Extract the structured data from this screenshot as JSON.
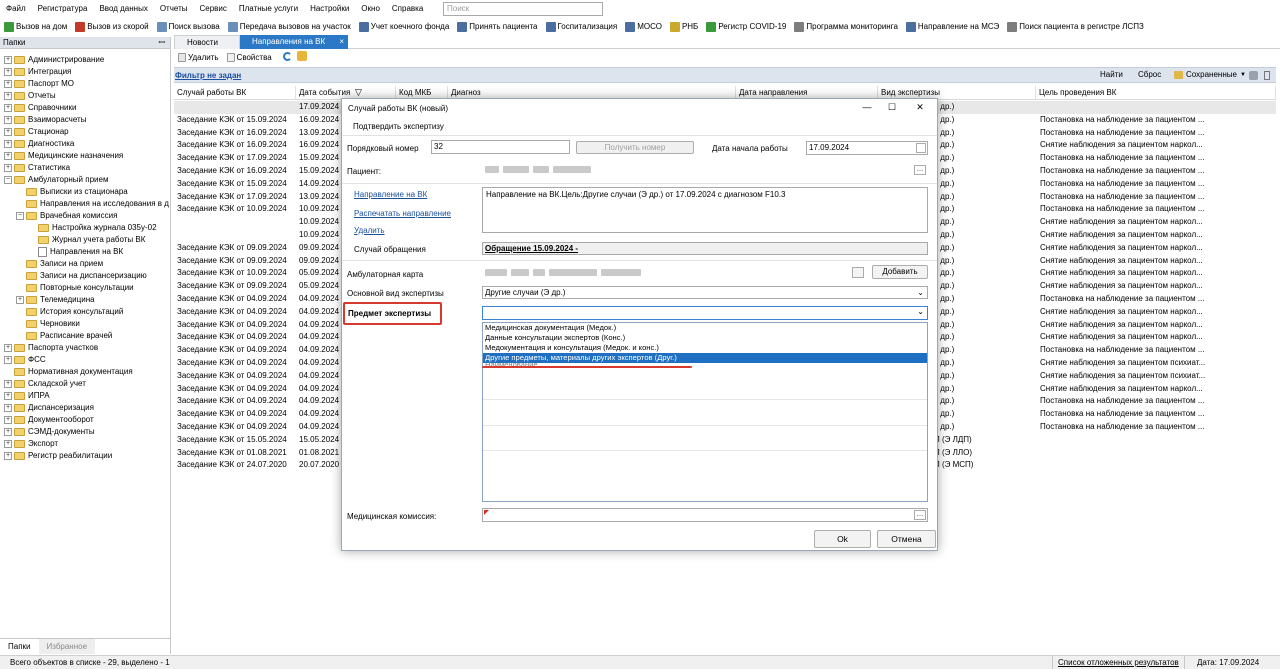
{
  "menu": [
    "Файл",
    "Регистратура",
    "Ввод данных",
    "Отчеты",
    "Сервис",
    "Платные услуги",
    "Настройки",
    "Окно",
    "Справка"
  ],
  "search_placeholder": "Поиск",
  "toolbar": [
    {
      "label": "Вызов на дом",
      "color": "#3a9a3a"
    },
    {
      "label": "Вызов из скорой",
      "color": "#c23a2a"
    },
    {
      "label": "Поиск вызова",
      "color": "#6a8fb8"
    },
    {
      "label": "Передача вызовов на участок",
      "color": "#6a8fb8"
    },
    {
      "label": "Учет коечного фонда",
      "color": "#4c6e9e"
    },
    {
      "label": "Принять пациента",
      "color": "#4c6e9e"
    },
    {
      "label": "Госпитализация",
      "color": "#4c6e9e"
    },
    {
      "label": "МОСО",
      "color": "#4c6e9e"
    },
    {
      "label": "РНБ",
      "color": "#c9a82c"
    },
    {
      "label": "Регистр COVID-19",
      "color": "#3a9a3a"
    },
    {
      "label": "Программа мониторинга",
      "color": "#7d7d7d"
    },
    {
      "label": "Направление на МСЭ",
      "color": "#4c6e9e"
    },
    {
      "label": "Поиск пациента в регистре ЛСПЗ",
      "color": "#7d7d7d"
    }
  ],
  "left_panel": {
    "title": "Папки",
    "pin": "ꟷ",
    "tree": [
      {
        "label": "Администрирование",
        "level": 0,
        "exp": "+",
        "icon": "folder"
      },
      {
        "label": "Интеграция",
        "level": 0,
        "exp": "+",
        "icon": "folder"
      },
      {
        "label": "Паспорт МО",
        "level": 0,
        "exp": "+",
        "icon": "folder"
      },
      {
        "label": "Отчеты",
        "level": 0,
        "exp": "+",
        "icon": "folder"
      },
      {
        "label": "Справочники",
        "level": 0,
        "exp": "+",
        "icon": "folder"
      },
      {
        "label": "Взаиморасчеты",
        "level": 0,
        "exp": "+",
        "icon": "folder"
      },
      {
        "label": "Стационар",
        "level": 0,
        "exp": "+",
        "icon": "folder"
      },
      {
        "label": "Диагностика",
        "level": 0,
        "exp": "+",
        "icon": "folder"
      },
      {
        "label": "Медицинские назначения",
        "level": 0,
        "exp": "+",
        "icon": "folder"
      },
      {
        "label": "Статистика",
        "level": 0,
        "exp": "+",
        "icon": "folder"
      },
      {
        "label": "Амбулаторный прием",
        "level": 0,
        "exp": "−",
        "icon": "folder"
      },
      {
        "label": "Выписки из стационара",
        "level": 1,
        "exp": "",
        "icon": "folder"
      },
      {
        "label": "Направления на исследования в д",
        "level": 1,
        "exp": "",
        "icon": "folder"
      },
      {
        "label": "Врачебная комиссия",
        "level": 1,
        "exp": "−",
        "icon": "folder"
      },
      {
        "label": "Настройка журнала 035у-02",
        "level": 2,
        "exp": "",
        "icon": "folder"
      },
      {
        "label": "Журнал учета работы ВК",
        "level": 2,
        "exp": "",
        "icon": "folder"
      },
      {
        "label": "Направления на ВК",
        "level": 2,
        "exp": "",
        "icon": "doc"
      },
      {
        "label": "Записи на прием",
        "level": 1,
        "exp": "",
        "icon": "folder"
      },
      {
        "label": "Записи на диспансеризацию",
        "level": 1,
        "exp": "",
        "icon": "folder"
      },
      {
        "label": "Повторные консультации",
        "level": 1,
        "exp": "",
        "icon": "folder"
      },
      {
        "label": "Телемедицина",
        "level": 1,
        "exp": "+",
        "icon": "folder"
      },
      {
        "label": "История консультаций",
        "level": 1,
        "exp": "",
        "icon": "folder"
      },
      {
        "label": "Черновики",
        "level": 1,
        "exp": "",
        "icon": "folder"
      },
      {
        "label": "Расписание врачей",
        "level": 1,
        "exp": "",
        "icon": "folder"
      },
      {
        "label": "Паспорта участков",
        "level": 0,
        "exp": "+",
        "icon": "folder"
      },
      {
        "label": "ФСС",
        "level": 0,
        "exp": "+",
        "icon": "folder"
      },
      {
        "label": "Нормативная документация",
        "level": 0,
        "exp": "",
        "icon": "folder"
      },
      {
        "label": "Складской учет",
        "level": 0,
        "exp": "+",
        "icon": "folder"
      },
      {
        "label": "ИПРА",
        "level": 0,
        "exp": "+",
        "icon": "folder"
      },
      {
        "label": "Диспансеризация",
        "level": 0,
        "exp": "+",
        "icon": "folder"
      },
      {
        "label": "Документооборот",
        "level": 0,
        "exp": "+",
        "icon": "folder"
      },
      {
        "label": "СЭМД-документы",
        "level": 0,
        "exp": "+",
        "icon": "folder"
      },
      {
        "label": "Экспорт",
        "level": 0,
        "exp": "+",
        "icon": "folder"
      },
      {
        "label": "Регистр реабилитации",
        "level": 0,
        "exp": "+",
        "icon": "folder"
      }
    ],
    "tabs": [
      "Папки",
      "Избранное"
    ]
  },
  "tabs": {
    "news": "Новости",
    "vk": "Направления на ВК",
    "close": "×"
  },
  "sub_toolbar": {
    "delete": "Удалить",
    "props": "Свойства"
  },
  "filter": {
    "link": "Фильтр не задан",
    "find": "Найти",
    "reset": "Сброс",
    "saved": "Сохраненные"
  },
  "table": {
    "headers": [
      "Случай работы ВК",
      "Дата события",
      "Код МКБ",
      "Диагноз",
      "Дата направления",
      "Вид экспертизы",
      "Цель проведения ВК"
    ],
    "rows": [
      {
        "case": "",
        "date": "17.09.2024",
        "kind": "э др.)",
        "goal": ""
      },
      {
        "case": "Заседание КЭК от 15.09.2024",
        "date": "16.09.2024",
        "kind": "э др.)",
        "goal": "Постановка на наблюдение за пациентом ..."
      },
      {
        "case": "Заседание КЭК от 16.09.2024",
        "date": "13.09.2024",
        "kind": "э др.)",
        "goal": "Постановка на наблюдение за пациентом ..."
      },
      {
        "case": "Заседание КЭК от 16.09.2024",
        "date": "16.09.2024",
        "kind": "э др.)",
        "goal": "Снятие наблюдения за пациентом наркол..."
      },
      {
        "case": "Заседание КЭК от 17.09.2024",
        "date": "15.09.2024",
        "kind": "э др.)",
        "goal": "Постановка на наблюдение за пациентом ..."
      },
      {
        "case": "Заседание КЭК от 16.09.2024",
        "date": "15.09.2024",
        "kind": "э др.)",
        "goal": "Постановка на наблюдение за пациентом ..."
      },
      {
        "case": "Заседание КЭК от 15.09.2024",
        "date": "14.09.2024",
        "kind": "э др.)",
        "goal": "Постановка на наблюдение за пациентом ..."
      },
      {
        "case": "Заседание КЭК от 17.09.2024",
        "date": "13.09.2024",
        "kind": "э др.)",
        "goal": "Постановка на наблюдение за пациентом ..."
      },
      {
        "case": "Заседание КЭК от 10.09.2024",
        "date": "10.09.2024",
        "kind": "э др.)",
        "goal": "Постановка на наблюдение за пациентом ..."
      },
      {
        "case": "",
        "date": "10.09.2024",
        "kind": "э др.)",
        "goal": "Снятие наблюдения за пациентом наркол..."
      },
      {
        "case": "",
        "date": "10.09.2024",
        "kind": "э др.)",
        "goal": "Снятие наблюдения за пациентом наркол..."
      },
      {
        "case": "Заседание КЭК от 09.09.2024",
        "date": "09.09.2024",
        "kind": "э др.)",
        "goal": "Снятие наблюдения за пациентом наркол..."
      },
      {
        "case": "Заседание КЭК от 09.09.2024",
        "date": "09.09.2024",
        "kind": "э др.)",
        "goal": "Снятие наблюдения за пациентом наркол..."
      },
      {
        "case": "Заседание КЭК от 10.09.2024",
        "date": "05.09.2024",
        "kind": "э др.)",
        "goal": "Снятие наблюдения за пациентом наркол..."
      },
      {
        "case": "Заседание КЭК от 09.09.2024",
        "date": "05.09.2024",
        "kind": "э др.)",
        "goal": "Снятие наблюдения за пациентом наркол..."
      },
      {
        "case": "Заседание КЭК от 04.09.2024",
        "date": "04.09.2024",
        "kind": "э др.)",
        "goal": "Постановка на наблюдение за пациентом ..."
      },
      {
        "case": "Заседание КЭК от 04.09.2024",
        "date": "04.09.2024",
        "kind": "э др.)",
        "goal": "Снятие наблюдения за пациентом наркол..."
      },
      {
        "case": "Заседание КЭК от 04.09.2024",
        "date": "04.09.2024",
        "kind": "э др.)",
        "goal": "Снятие наблюдения за пациентом наркол..."
      },
      {
        "case": "Заседание КЭК от 04.09.2024",
        "date": "04.09.2024",
        "kind": "э др.)",
        "goal": "Снятие наблюдения за пациентом наркол..."
      },
      {
        "case": "Заседание КЭК от 04.09.2024",
        "date": "04.09.2024",
        "kind": "э др.)",
        "goal": "Постановка на наблюдение за пациентом ..."
      },
      {
        "case": "Заседание КЭК от 04.09.2024",
        "date": "04.09.2024",
        "kind": "э др.)",
        "goal": "Снятие наблюдения за пациентом психиат..."
      },
      {
        "case": "Заседание КЭК от 04.09.2024",
        "date": "04.09.2024",
        "kind": "э др.)",
        "goal": "Снятие наблюдения за пациентом психиат..."
      },
      {
        "case": "Заседание КЭК от 04.09.2024",
        "date": "04.09.2024",
        "kind": "э др.)",
        "goal": "Снятие наблюдения за пациентом наркол..."
      },
      {
        "case": "Заседание КЭК от 04.09.2024",
        "date": "04.09.2024",
        "kind": "э др.)",
        "goal": "Постановка на наблюдение за пациентом ..."
      },
      {
        "case": "Заседание КЭК от 04.09.2024",
        "date": "04.09.2024",
        "kind": "э др.)",
        "goal": "Постановка на наблюдение за пациентом ..."
      },
      {
        "case": "Заседание КЭК от 04.09.2024",
        "date": "04.09.2024",
        "kind": "э др.)",
        "goal": "Постановка на наблюдение за пациентом ..."
      },
      {
        "case": "Заседание КЭК от 15.05.2024",
        "date": "15.05.2024",
        "kind": "П (Э ЛДП)",
        "goal": ""
      },
      {
        "case": "Заседание КЭК от 01.08.2021",
        "date": "01.08.2021",
        "kind": "П (Э ЛЛО)",
        "goal": ""
      },
      {
        "case": "Заседание КЭК от 24.07.2020",
        "date": "20.07.2020",
        "kind": "П (Э МСП)",
        "goal": ""
      }
    ]
  },
  "status": {
    "left": "Всего объектов в списке - 29, выделено - 1",
    "deferred": "Список отложенных результатов",
    "date": "Дата: 17.09.2024"
  },
  "dialog": {
    "title": "Случай работы ВК (новый)",
    "confirm": "Подтвердить экспертизу",
    "order_label": "Порядковый номер",
    "order_value": "32",
    "get_number": "Получить номер",
    "start_date_label": "Дата начала работы",
    "start_date_value": "17.09.2024",
    "patient_label": "Пациент:",
    "link_direction": "Направление на ВК",
    "link_print": "Распечатать направление",
    "link_delete": "Удалить",
    "direction_text": "Направление на ВК.Цель:Другие случаи (Э др.) от 17.09.2024 с диагнозом F10.3",
    "appeal_label": "Случай обращения",
    "appeal_value": "Обращение 15.09.2024 -",
    "card_label": "Амбулаторная карта",
    "add_button": "Добавить",
    "main_kind_label": "Основной вид экспертизы",
    "main_kind_value": "Другие случаи (Э др.)",
    "subject_label": "Предмет экспертизы",
    "options": [
      "Медицинская документация (Медок.)",
      "Данные консультации экспертов (Конс.)",
      "Медокументация и консультация (Медок. и конс.)",
      "Другие предметы, материалы других экспертов (Друг.)"
    ],
    "hidden_option": "Наименование",
    "commission_label": "Медицинская комиссия:",
    "ok": "Ok",
    "cancel": "Отмена"
  }
}
